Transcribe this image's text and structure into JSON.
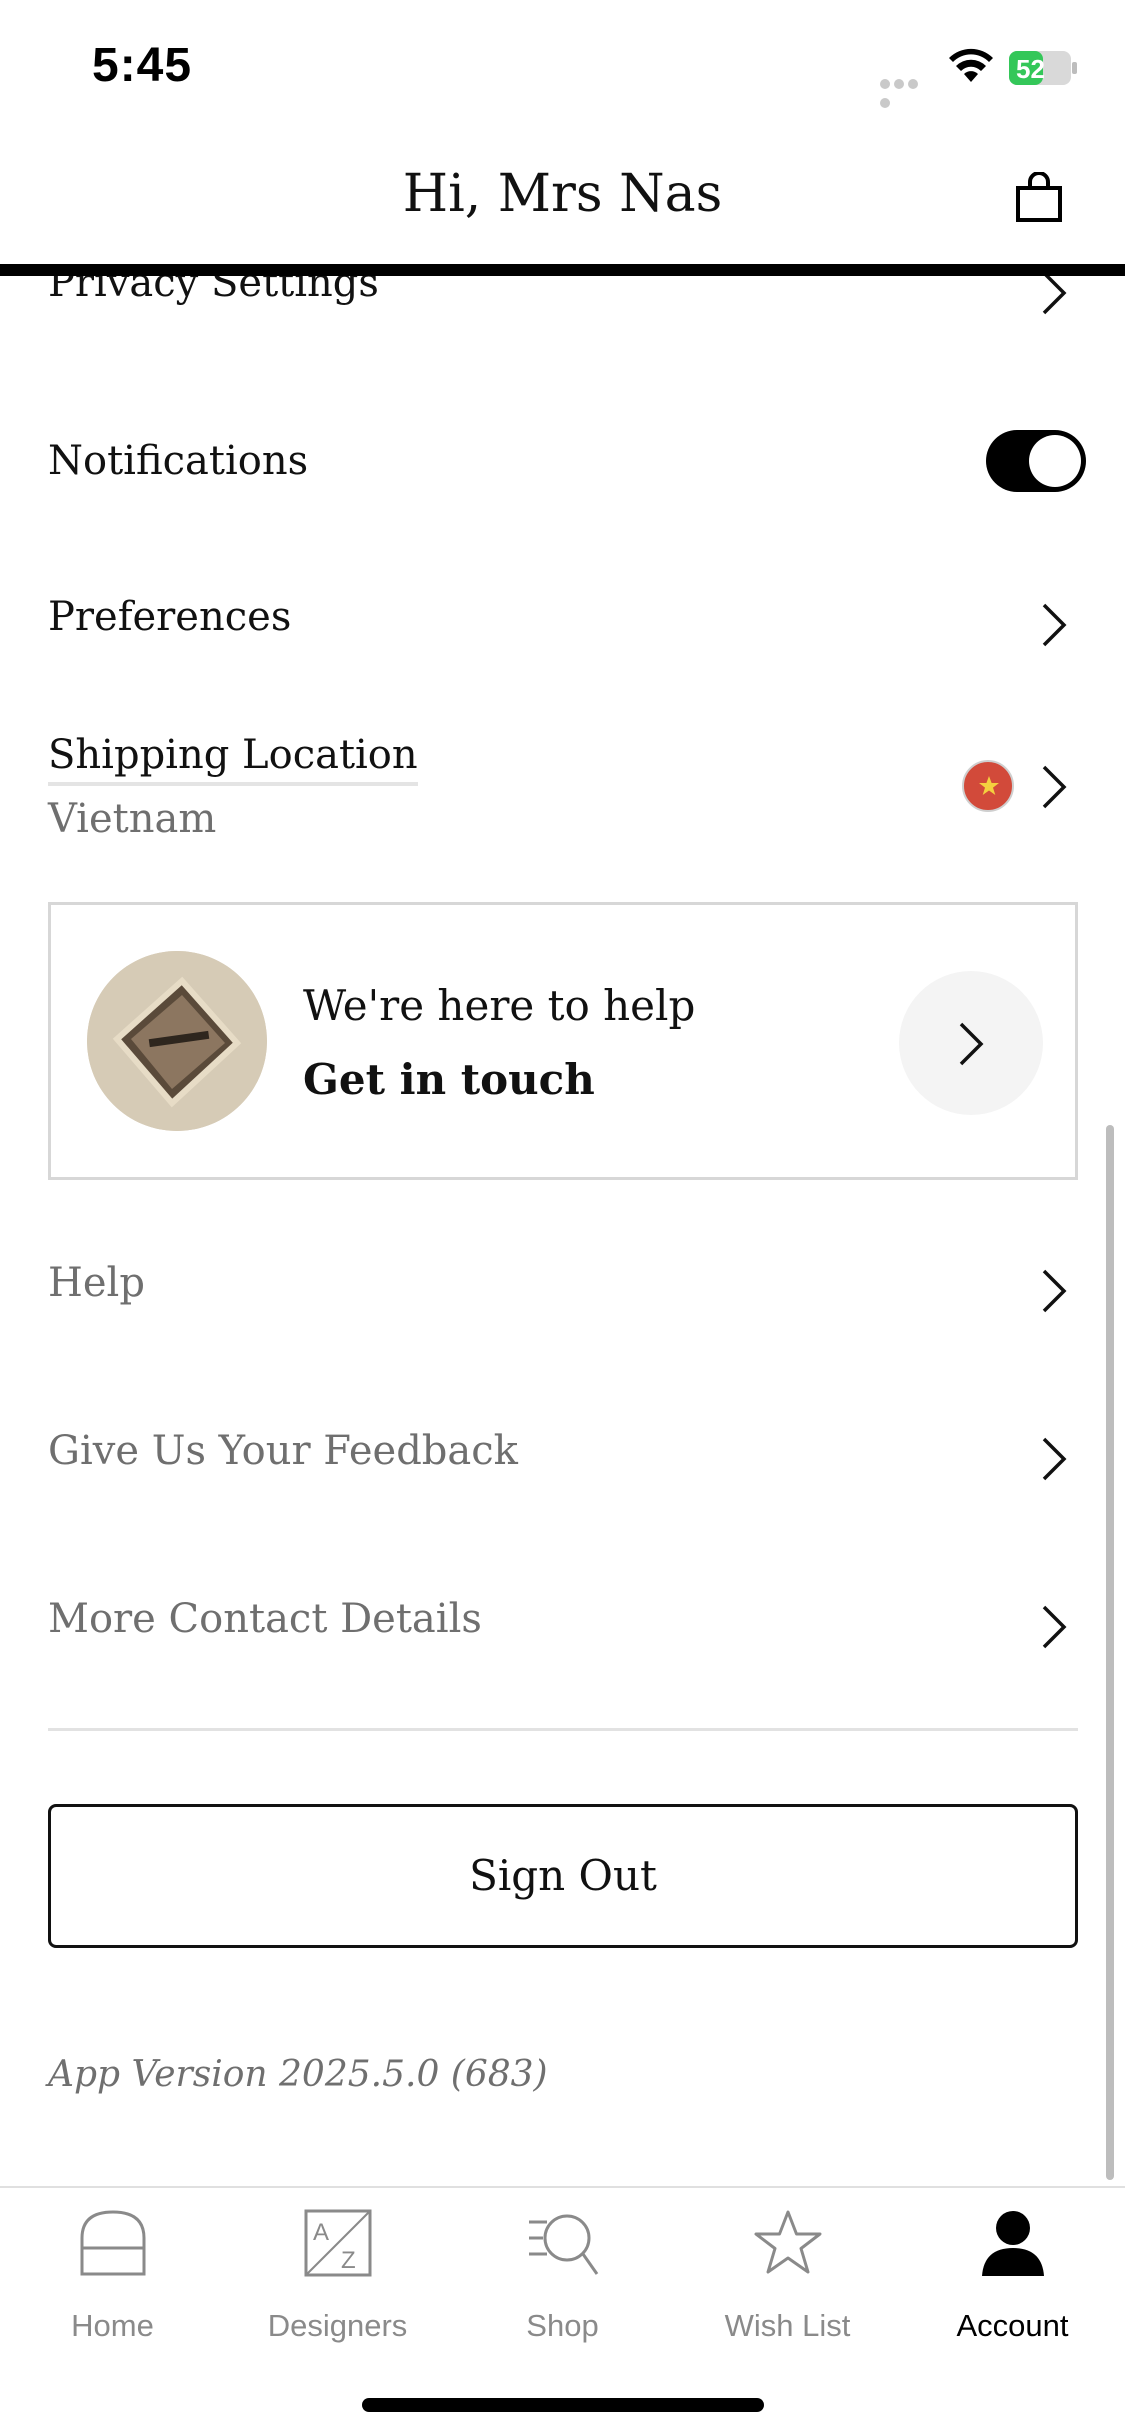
{
  "status_bar": {
    "time": "5:45",
    "battery": "52"
  },
  "header": {
    "title": "Hi, Mrs Nas"
  },
  "menu": {
    "privacy": "Privacy Settings",
    "notifications": "Notifications",
    "notifications_on": true,
    "preferences": "Preferences",
    "shipping_label": "Shipping Location",
    "shipping_value": "Vietnam"
  },
  "help_card": {
    "line1": "We're here to help",
    "line2": "Get in touch"
  },
  "links": {
    "help": "Help",
    "feedback": "Give Us Your Feedback",
    "contact": "More Contact Details"
  },
  "sign_out": "Sign Out",
  "app_version": "App Version 2025.5.0 (683)",
  "tabs": [
    {
      "label": "Home",
      "icon": "home-icon"
    },
    {
      "label": "Designers",
      "icon": "designers-az-icon"
    },
    {
      "label": "Shop",
      "icon": "shop-search-icon"
    },
    {
      "label": "Wish List",
      "icon": "star-icon"
    },
    {
      "label": "Account",
      "icon": "account-icon",
      "active": true
    }
  ],
  "colors": {
    "accent": "#000000",
    "muted": "#6f6f6f",
    "flag_red": "#d24a3a",
    "flag_star": "#f4d03f"
  }
}
